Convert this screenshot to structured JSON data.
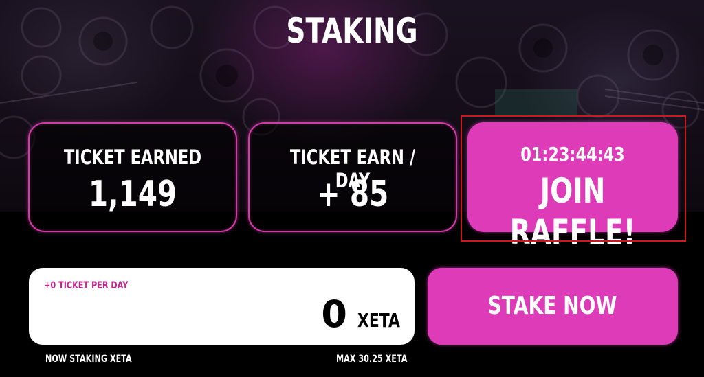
{
  "page": {
    "title": "STAKING"
  },
  "stats": {
    "ticket_earned_label": "TICKET EARNED",
    "ticket_earned_value": "1,149",
    "ticket_per_day_label": "TICKET EARN / DAY",
    "ticket_per_day_value": "+ 85"
  },
  "raffle": {
    "countdown": "01:23:44:43",
    "cta_label": "JOIN RAFFLE!"
  },
  "stake": {
    "ticket_preview": "+0 TICKET PER DAY",
    "amount_value": "0",
    "unit": "XETA",
    "button_label": "STAKE NOW",
    "now_staking_label": "NOW STAKING XETA",
    "max_label": "MAX 30.25 XETA"
  },
  "colors": {
    "accent": "#de3bb8",
    "accent_border": "#d43aa8",
    "highlight_outline": "#d2161f",
    "background": "#000000",
    "ticket_preview_text": "#c0288e"
  }
}
